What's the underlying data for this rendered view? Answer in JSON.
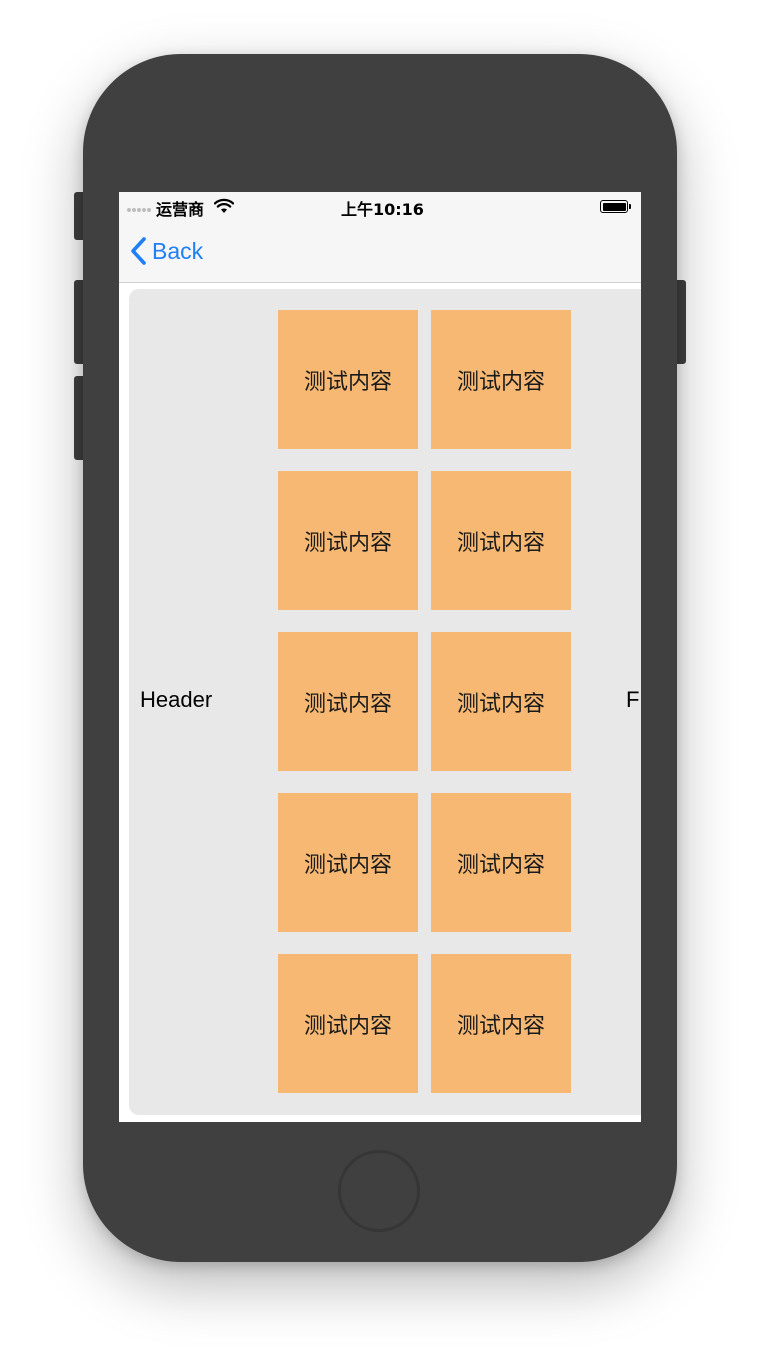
{
  "status_bar": {
    "carrier": "运营商",
    "time": "上午10:16"
  },
  "nav": {
    "back_label": "Back"
  },
  "section": {
    "header": "Header",
    "footer": "F",
    "items": [
      {
        "label": "测试内容"
      },
      {
        "label": "测试内容"
      },
      {
        "label": "测试内容"
      },
      {
        "label": "测试内容"
      },
      {
        "label": "测试内容"
      },
      {
        "label": "测试内容"
      },
      {
        "label": "测试内容"
      },
      {
        "label": "测试内容"
      },
      {
        "label": "测试内容"
      },
      {
        "label": "测试内容"
      }
    ]
  },
  "colors": {
    "accent": "#1f7ff5",
    "cell": "#f6b872",
    "section_background": "#e8e8e8",
    "device": "#404040"
  },
  "icons": {
    "back": "chevron-left-icon",
    "wifi": "wifi-icon",
    "battery": "battery-icon",
    "signal": "signal-dots-icon"
  }
}
